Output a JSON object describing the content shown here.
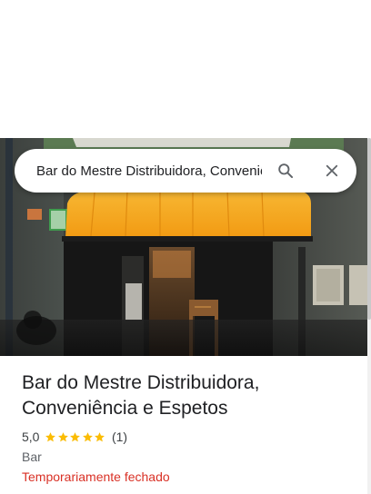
{
  "search": {
    "value": "Bar do Mestre Distribuidora, Conveniência e Espetos",
    "search_icon": "search-icon",
    "close_icon": "close-icon"
  },
  "photo": {
    "description_icon": "storefront-photo"
  },
  "place": {
    "name": "Bar do Mestre Distribuidora, Conveniência e Espetos",
    "rating": "5,0",
    "stars": 5,
    "review_count": "(1)",
    "category": "Bar",
    "status": "Temporariamente fechado"
  },
  "colors": {
    "star": "#fbbc04",
    "status_closed": "#d93025",
    "awning": "#f4a51c"
  }
}
